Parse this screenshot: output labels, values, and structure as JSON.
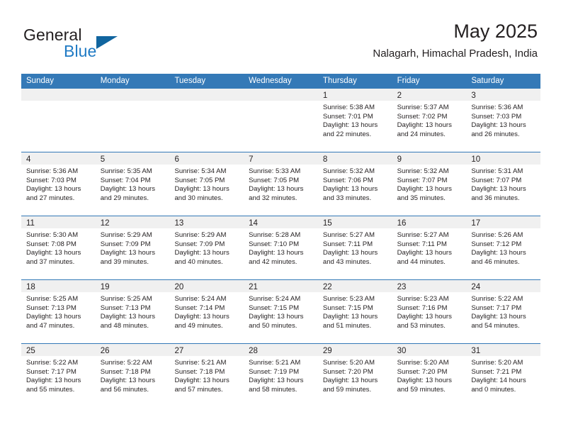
{
  "brand": {
    "general": "General",
    "blue": "Blue",
    "triangle_color": "#11659f",
    "blue_color": "#1f7ac4"
  },
  "header": {
    "title": "May 2025",
    "subtitle": "Nalagarh, Himachal Pradesh, India",
    "header_bg": "#3479b7",
    "day_band_bg": "#f0f0f0"
  },
  "weekdays": [
    "Sunday",
    "Monday",
    "Tuesday",
    "Wednesday",
    "Thursday",
    "Friday",
    "Saturday"
  ],
  "weeks": [
    [
      {
        "day": "",
        "lines": []
      },
      {
        "day": "",
        "lines": []
      },
      {
        "day": "",
        "lines": []
      },
      {
        "day": "",
        "lines": []
      },
      {
        "day": "1",
        "lines": [
          "Sunrise: 5:38 AM",
          "Sunset: 7:01 PM",
          "Daylight: 13 hours",
          "and 22 minutes."
        ]
      },
      {
        "day": "2",
        "lines": [
          "Sunrise: 5:37 AM",
          "Sunset: 7:02 PM",
          "Daylight: 13 hours",
          "and 24 minutes."
        ]
      },
      {
        "day": "3",
        "lines": [
          "Sunrise: 5:36 AM",
          "Sunset: 7:03 PM",
          "Daylight: 13 hours",
          "and 26 minutes."
        ]
      }
    ],
    [
      {
        "day": "4",
        "lines": [
          "Sunrise: 5:36 AM",
          "Sunset: 7:03 PM",
          "Daylight: 13 hours",
          "and 27 minutes."
        ]
      },
      {
        "day": "5",
        "lines": [
          "Sunrise: 5:35 AM",
          "Sunset: 7:04 PM",
          "Daylight: 13 hours",
          "and 29 minutes."
        ]
      },
      {
        "day": "6",
        "lines": [
          "Sunrise: 5:34 AM",
          "Sunset: 7:05 PM",
          "Daylight: 13 hours",
          "and 30 minutes."
        ]
      },
      {
        "day": "7",
        "lines": [
          "Sunrise: 5:33 AM",
          "Sunset: 7:05 PM",
          "Daylight: 13 hours",
          "and 32 minutes."
        ]
      },
      {
        "day": "8",
        "lines": [
          "Sunrise: 5:32 AM",
          "Sunset: 7:06 PM",
          "Daylight: 13 hours",
          "and 33 minutes."
        ]
      },
      {
        "day": "9",
        "lines": [
          "Sunrise: 5:32 AM",
          "Sunset: 7:07 PM",
          "Daylight: 13 hours",
          "and 35 minutes."
        ]
      },
      {
        "day": "10",
        "lines": [
          "Sunrise: 5:31 AM",
          "Sunset: 7:07 PM",
          "Daylight: 13 hours",
          "and 36 minutes."
        ]
      }
    ],
    [
      {
        "day": "11",
        "lines": [
          "Sunrise: 5:30 AM",
          "Sunset: 7:08 PM",
          "Daylight: 13 hours",
          "and 37 minutes."
        ]
      },
      {
        "day": "12",
        "lines": [
          "Sunrise: 5:29 AM",
          "Sunset: 7:09 PM",
          "Daylight: 13 hours",
          "and 39 minutes."
        ]
      },
      {
        "day": "13",
        "lines": [
          "Sunrise: 5:29 AM",
          "Sunset: 7:09 PM",
          "Daylight: 13 hours",
          "and 40 minutes."
        ]
      },
      {
        "day": "14",
        "lines": [
          "Sunrise: 5:28 AM",
          "Sunset: 7:10 PM",
          "Daylight: 13 hours",
          "and 42 minutes."
        ]
      },
      {
        "day": "15",
        "lines": [
          "Sunrise: 5:27 AM",
          "Sunset: 7:11 PM",
          "Daylight: 13 hours",
          "and 43 minutes."
        ]
      },
      {
        "day": "16",
        "lines": [
          "Sunrise: 5:27 AM",
          "Sunset: 7:11 PM",
          "Daylight: 13 hours",
          "and 44 minutes."
        ]
      },
      {
        "day": "17",
        "lines": [
          "Sunrise: 5:26 AM",
          "Sunset: 7:12 PM",
          "Daylight: 13 hours",
          "and 46 minutes."
        ]
      }
    ],
    [
      {
        "day": "18",
        "lines": [
          "Sunrise: 5:25 AM",
          "Sunset: 7:13 PM",
          "Daylight: 13 hours",
          "and 47 minutes."
        ]
      },
      {
        "day": "19",
        "lines": [
          "Sunrise: 5:25 AM",
          "Sunset: 7:13 PM",
          "Daylight: 13 hours",
          "and 48 minutes."
        ]
      },
      {
        "day": "20",
        "lines": [
          "Sunrise: 5:24 AM",
          "Sunset: 7:14 PM",
          "Daylight: 13 hours",
          "and 49 minutes."
        ]
      },
      {
        "day": "21",
        "lines": [
          "Sunrise: 5:24 AM",
          "Sunset: 7:15 PM",
          "Daylight: 13 hours",
          "and 50 minutes."
        ]
      },
      {
        "day": "22",
        "lines": [
          "Sunrise: 5:23 AM",
          "Sunset: 7:15 PM",
          "Daylight: 13 hours",
          "and 51 minutes."
        ]
      },
      {
        "day": "23",
        "lines": [
          "Sunrise: 5:23 AM",
          "Sunset: 7:16 PM",
          "Daylight: 13 hours",
          "and 53 minutes."
        ]
      },
      {
        "day": "24",
        "lines": [
          "Sunrise: 5:22 AM",
          "Sunset: 7:17 PM",
          "Daylight: 13 hours",
          "and 54 minutes."
        ]
      }
    ],
    [
      {
        "day": "25",
        "lines": [
          "Sunrise: 5:22 AM",
          "Sunset: 7:17 PM",
          "Daylight: 13 hours",
          "and 55 minutes."
        ]
      },
      {
        "day": "26",
        "lines": [
          "Sunrise: 5:22 AM",
          "Sunset: 7:18 PM",
          "Daylight: 13 hours",
          "and 56 minutes."
        ]
      },
      {
        "day": "27",
        "lines": [
          "Sunrise: 5:21 AM",
          "Sunset: 7:18 PM",
          "Daylight: 13 hours",
          "and 57 minutes."
        ]
      },
      {
        "day": "28",
        "lines": [
          "Sunrise: 5:21 AM",
          "Sunset: 7:19 PM",
          "Daylight: 13 hours",
          "and 58 minutes."
        ]
      },
      {
        "day": "29",
        "lines": [
          "Sunrise: 5:20 AM",
          "Sunset: 7:20 PM",
          "Daylight: 13 hours",
          "and 59 minutes."
        ]
      },
      {
        "day": "30",
        "lines": [
          "Sunrise: 5:20 AM",
          "Sunset: 7:20 PM",
          "Daylight: 13 hours",
          "and 59 minutes."
        ]
      },
      {
        "day": "31",
        "lines": [
          "Sunrise: 5:20 AM",
          "Sunset: 7:21 PM",
          "Daylight: 14 hours",
          "and 0 minutes."
        ]
      }
    ]
  ]
}
